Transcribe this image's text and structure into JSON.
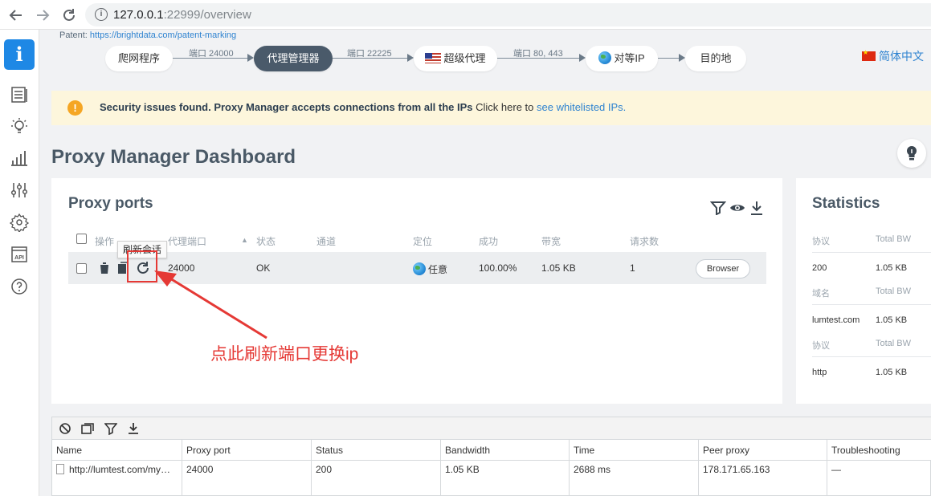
{
  "browser": {
    "url_host": "127.0.0.1",
    "url_path": ":22999/overview"
  },
  "patent": {
    "label": "Patent:",
    "link": "https://brightdata.com/patent-marking"
  },
  "flow": {
    "nodes": [
      "爬网程序",
      "代理管理器",
      "超级代理",
      "对等IP",
      "目的地"
    ],
    "edges": [
      "端口 24000",
      "端口 22225",
      "端口 80, 443"
    ]
  },
  "language": "简体中文",
  "warning": {
    "bold": "Security issues found. Proxy Manager accepts connections from all the IPs",
    "plain": " Click here to ",
    "link": "see whitelisted IPs."
  },
  "title": "Proxy Manager Dashboard",
  "proxy_ports": {
    "title": "Proxy ports",
    "headers": [
      "操作",
      "代理端口",
      "状态",
      "通道",
      "定位",
      "成功",
      "带宽",
      "请求数"
    ],
    "row": {
      "port": "24000",
      "status": "OK",
      "location": "任意",
      "success": "100.00%",
      "bandwidth": "1.05 KB",
      "requests": "1",
      "button": "Browser"
    },
    "tooltip": "刷新会话"
  },
  "annotation": "点此刷新端口更换ip",
  "statistics": {
    "title": "Statistics",
    "groups": [
      {
        "h1": "协议",
        "h2": "Total BW",
        "v1": "200",
        "v2": "1.05 KB"
      },
      {
        "h1": "域名",
        "h2": "Total BW",
        "v1": "lumtest.com",
        "v2": "1.05 KB"
      },
      {
        "h1": "协议",
        "h2": "Total BW",
        "v1": "http",
        "v2": "1.05 KB"
      }
    ]
  },
  "log": {
    "columns": [
      "Name",
      "Proxy port",
      "Status",
      "Bandwidth",
      "Time",
      "Peer proxy",
      "Troubleshooting"
    ],
    "row": [
      "http://lumtest.com/my…",
      "24000",
      "200",
      "1.05 KB",
      "2688 ms",
      "178.171.65.163",
      "—"
    ]
  },
  "colors": {
    "accent": "#1e88e5",
    "dark_pill": "#4a5a6a",
    "warning_bg": "#fdf6dc",
    "annotation_red": "#e53935"
  }
}
